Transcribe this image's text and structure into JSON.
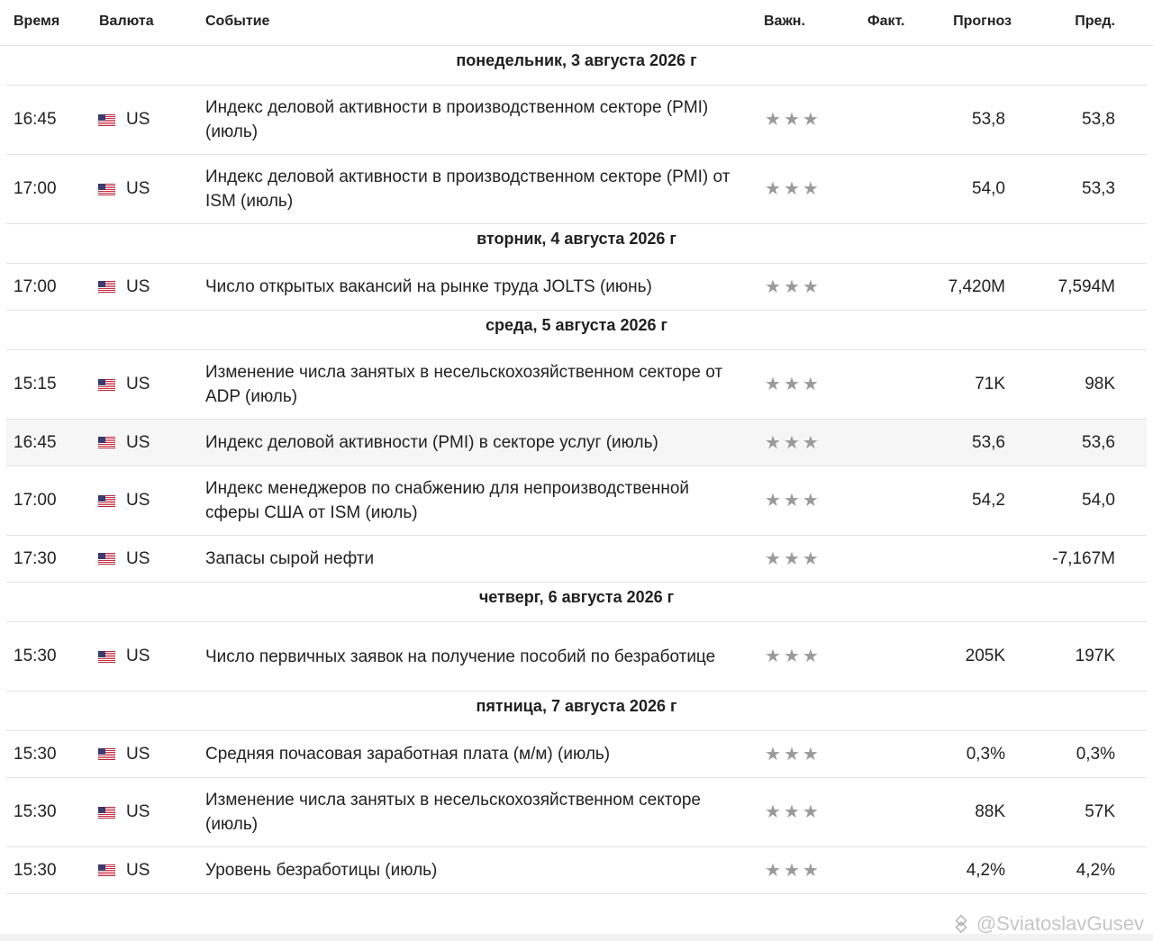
{
  "header": {
    "time": "Время",
    "currency": "Валюта",
    "event": "Событие",
    "importance": "Важн.",
    "actual": "Факт.",
    "forecast": "Прогноз",
    "previous": "Пред."
  },
  "flag_icon": "us-flag-icon",
  "star_icon": "star-icon",
  "colors": {
    "star": "#9a9a9a",
    "divider": "#e3e3e3",
    "alt_row": "#f6f6f6"
  },
  "rows": [
    {
      "type": "day",
      "label": "понедельник, 3 августа 2026 г"
    },
    {
      "type": "event",
      "time": "16:45",
      "currency": "US",
      "event": "Индекс деловой активности в производственном секторе (PMI)  (июль)",
      "importance": 3,
      "actual": "",
      "forecast": "53,8",
      "previous": "53,8",
      "lines": 2
    },
    {
      "type": "event",
      "time": "17:00",
      "currency": "US",
      "event": "Индекс деловой активности в производственном секторе (PMI) от ISM  (июль)",
      "importance": 3,
      "actual": "",
      "forecast": "54,0",
      "previous": "53,3",
      "lines": 2
    },
    {
      "type": "day",
      "label": "вторник, 4 августа 2026 г"
    },
    {
      "type": "event",
      "time": "17:00",
      "currency": "US",
      "event": "Число открытых вакансий на рынке труда JOLTS  (июнь)",
      "importance": 3,
      "actual": "",
      "forecast": "7,420M",
      "previous": "7,594M",
      "lines": 1
    },
    {
      "type": "day",
      "label": "среда, 5 августа 2026 г"
    },
    {
      "type": "event",
      "time": "15:15",
      "currency": "US",
      "event": "Изменение числа занятых в несельскохозяйственном секторе от ADP  (июль)",
      "importance": 3,
      "actual": "",
      "forecast": "71K",
      "previous": "98K",
      "lines": 2
    },
    {
      "type": "event",
      "time": "16:45",
      "currency": "US",
      "event": "Индекс деловой активности (PMI) в секторе услуг  (июль)",
      "importance": 3,
      "actual": "",
      "forecast": "53,6",
      "previous": "53,6",
      "lines": 1,
      "highlight": true
    },
    {
      "type": "event",
      "time": "17:00",
      "currency": "US",
      "event": "Индекс менеджеров по снабжению для непроизводственной сферы США от ISM  (июль)",
      "importance": 3,
      "actual": "",
      "forecast": "54,2",
      "previous": "54,0",
      "lines": 2
    },
    {
      "type": "event",
      "time": "17:30",
      "currency": "US",
      "event": "Запасы сырой нефти",
      "importance": 3,
      "actual": "",
      "forecast": "",
      "previous": "-7,167M",
      "lines": 1
    },
    {
      "type": "day",
      "label": "четверг, 6 августа 2026 г"
    },
    {
      "type": "event",
      "time": "15:30",
      "currency": "US",
      "event": "Число первичных заявок на получение пособий по безработице",
      "importance": 3,
      "actual": "",
      "forecast": "205K",
      "previous": "197K",
      "lines": 2
    },
    {
      "type": "day",
      "label": "пятница, 7 августа 2026 г"
    },
    {
      "type": "event",
      "time": "15:30",
      "currency": "US",
      "event": "Средняя почасовая заработная плата (м/м) (июль)",
      "importance": 3,
      "actual": "",
      "forecast": "0,3%",
      "previous": "0,3%",
      "lines": 1
    },
    {
      "type": "event",
      "time": "15:30",
      "currency": "US",
      "event": "Изменение числа занятых в несельскохозяйственном секторе  (июль)",
      "importance": 3,
      "actual": "",
      "forecast": "88K",
      "previous": "57K",
      "lines": 2
    },
    {
      "type": "event",
      "time": "15:30",
      "currency": "US",
      "event": "Уровень безработицы  (июль)",
      "importance": 3,
      "actual": "",
      "forecast": "4,2%",
      "previous": "4,2%",
      "lines": 1
    }
  ],
  "watermark": {
    "text": "@SviatoslavGusev",
    "icon": "watermark-logo-icon"
  }
}
